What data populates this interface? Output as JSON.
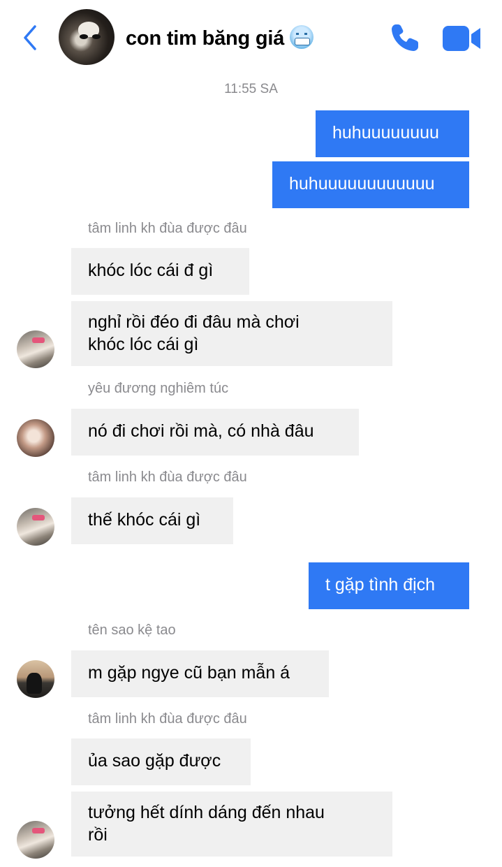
{
  "header": {
    "title": "con tim băng giá",
    "title_emoji": "cold-face-emoji",
    "accent_color": "#2f79f4",
    "icons": [
      "back-chevron-icon",
      "phone-icon",
      "video-camera-icon"
    ]
  },
  "timestamp": "11:55 SA",
  "messages": [
    {
      "from": "me",
      "text": "huhuuuuuuuu"
    },
    {
      "from": "me",
      "text": "huhuuuuuuuuuuuu"
    },
    {
      "sender": "tâm linh kh đùa được đâu",
      "text": "khóc lóc cái đ gì"
    },
    {
      "text_lines": [
        "nghỉ rồi đéo đi đâu mà chơi",
        "khóc lóc cái gì"
      ]
    },
    {
      "sender": "yêu đương nghiêm túc",
      "text": "nó đi chơi rồi mà, có nhà đâu"
    },
    {
      "sender": "tâm linh kh đùa được đâu",
      "text": "thế khóc cái gì"
    },
    {
      "from": "me",
      "text": "t gặp tình địch"
    },
    {
      "sender": "tên sao kệ tao",
      "text": "m gặp ngye cũ bạn mẫn á"
    },
    {
      "sender": "tâm linh kh đùa được đâu",
      "text": "ủa sao gặp được"
    },
    {
      "text_lines": [
        "tưởng hết dính dáng đến nhau",
        "rồi"
      ]
    }
  ],
  "colors": {
    "outgoing_bubble": "#2f79f4",
    "incoming_bubble": "#f0f0f0",
    "meta_text": "#8a8a8e"
  }
}
